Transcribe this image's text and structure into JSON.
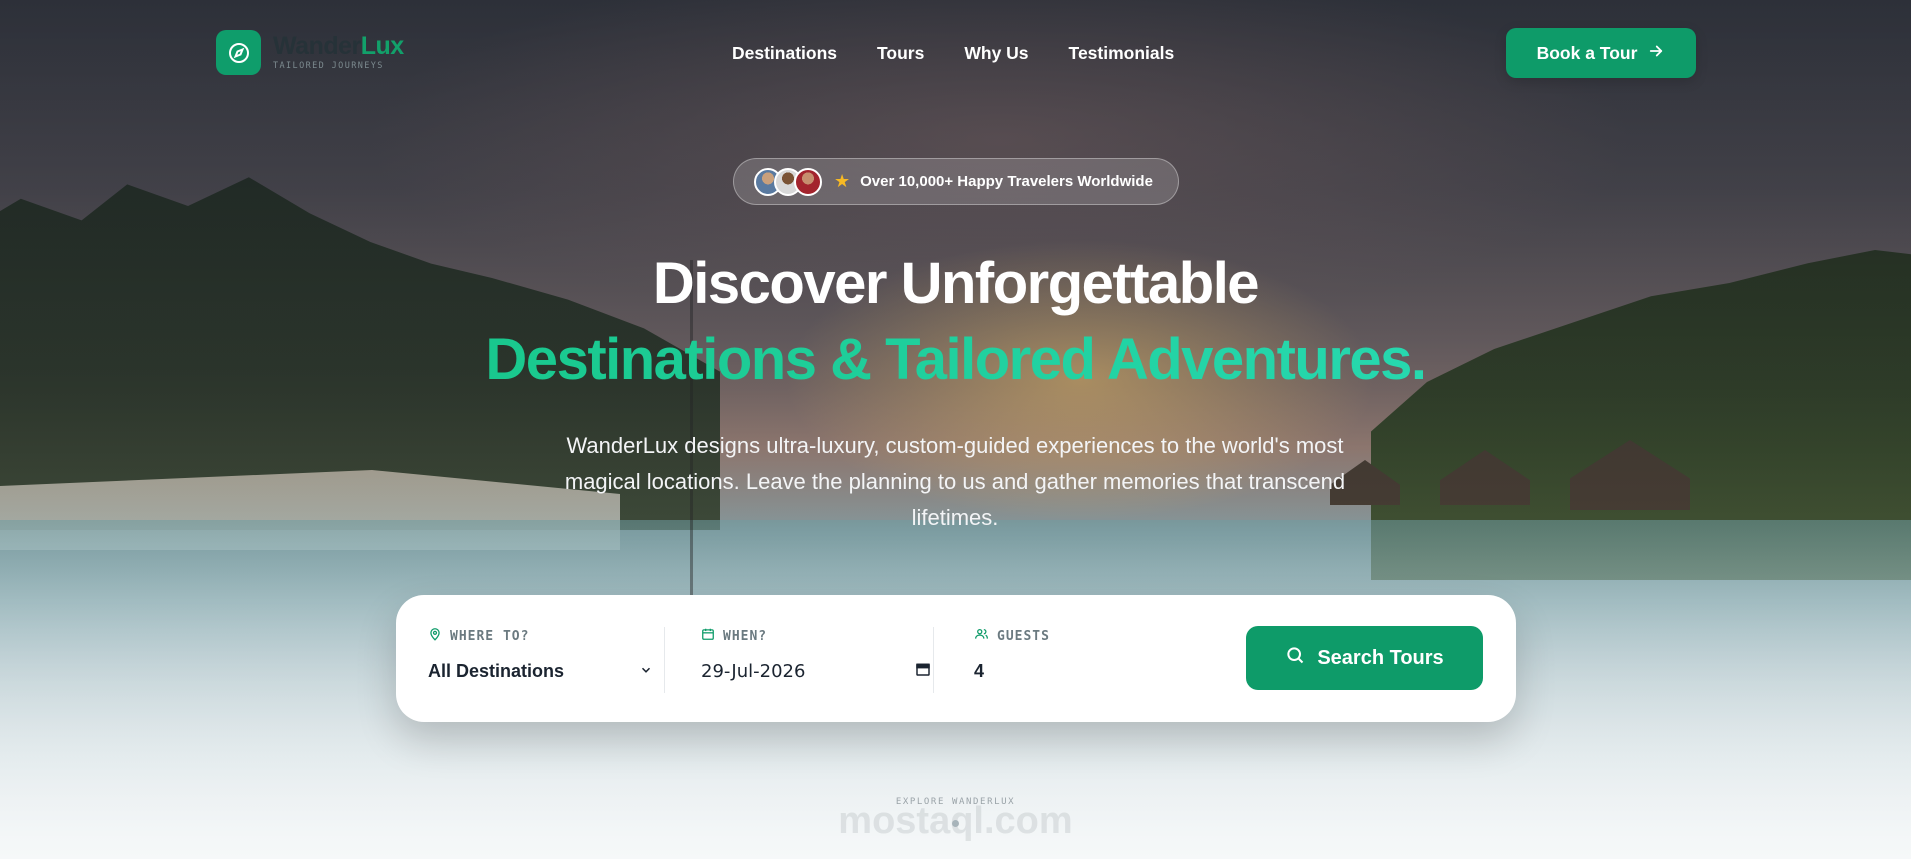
{
  "brand": {
    "name_part1": "Wander",
    "name_part2": "Lux",
    "tagline": "TAILORED JOURNEYS",
    "accent": "#0e9b69"
  },
  "nav": {
    "links": [
      "Destinations",
      "Tours",
      "Why Us",
      "Testimonials"
    ],
    "cta_label": "Book a Tour",
    "cta_icon": "arrow-right-icon"
  },
  "hero": {
    "badge_text": "Over 10,000+ Happy Travelers Worldwide",
    "title_line1": "Discover Unforgettable",
    "title_line2": "Destinations & Tailored Adventures.",
    "subtitle": "WanderLux designs ultra-luxury, custom-guided experiences to the world's most magical locations. Leave the planning to us and gather memories that transcend lifetimes."
  },
  "search": {
    "destination": {
      "label": "WHERE TO?",
      "value": "All Destinations",
      "icon": "map-pin-icon"
    },
    "date": {
      "label": "WHEN?",
      "value": "29-Jul-2026",
      "icon": "calendar-icon"
    },
    "guests": {
      "label": "GUESTS",
      "value": "4",
      "icon": "users-icon"
    },
    "button_label": "Search Tours",
    "button_icon": "search-icon"
  },
  "footer": {
    "explore_label": "EXPLORE WANDERLUX",
    "watermark": "mostaql.com"
  }
}
